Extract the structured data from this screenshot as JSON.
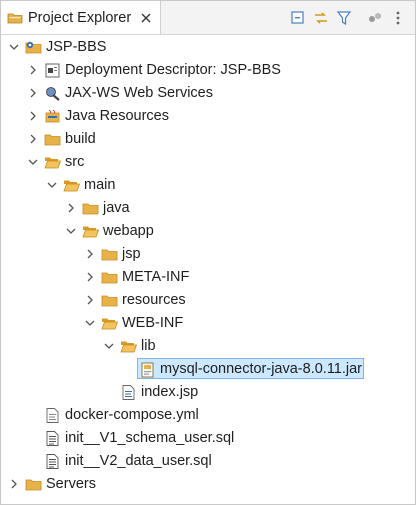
{
  "view": {
    "tab_title": "Project Explorer",
    "tab_icon": "folder-icon",
    "toolbar": [
      "collapse-all-icon",
      "link-with-editor-icon",
      "filter-icon",
      "focus-icon",
      "view-menu-icon"
    ]
  },
  "tree": {
    "rows": [
      {
        "label": "JSP-BBS",
        "icon": "project-icon",
        "state": "expanded"
      },
      {
        "label": "Deployment Descriptor: JSP-BBS",
        "icon": "deployment-descriptor-icon",
        "state": "collapsed"
      },
      {
        "label": "JAX-WS Web Services",
        "icon": "web-services-icon",
        "state": "collapsed"
      },
      {
        "label": "Java Resources",
        "icon": "java-resources-icon",
        "state": "collapsed"
      },
      {
        "label": "build",
        "icon": "folder-icon",
        "state": "collapsed"
      },
      {
        "label": "src",
        "icon": "folder-open-icon",
        "state": "expanded"
      },
      {
        "label": "main",
        "icon": "folder-open-icon",
        "state": "expanded"
      },
      {
        "label": "java",
        "icon": "folder-icon",
        "state": "collapsed"
      },
      {
        "label": "webapp",
        "icon": "folder-open-icon",
        "state": "expanded"
      },
      {
        "label": "jsp",
        "icon": "folder-icon",
        "state": "collapsed"
      },
      {
        "label": "META-INF",
        "icon": "folder-icon",
        "state": "collapsed"
      },
      {
        "label": "resources",
        "icon": "folder-icon",
        "state": "collapsed"
      },
      {
        "label": "WEB-INF",
        "icon": "folder-open-icon",
        "state": "expanded"
      },
      {
        "label": "lib",
        "icon": "folder-open-icon",
        "state": "expanded"
      },
      {
        "label": "mysql-connector-java-8.0.11.jar",
        "icon": "jar-icon",
        "state": "leaf",
        "selected": true
      },
      {
        "label": "index.jsp",
        "icon": "jsp-file-icon",
        "state": "leaf"
      },
      {
        "label": "docker-compose.yml",
        "icon": "yml-file-icon",
        "state": "leaf"
      },
      {
        "label": "init__V1_schema_user.sql",
        "icon": "sql-file-icon",
        "state": "leaf"
      },
      {
        "label": "init__V2_data_user.sql",
        "icon": "sql-file-icon",
        "state": "leaf"
      },
      {
        "label": "Servers",
        "icon": "folder-icon",
        "state": "collapsed"
      }
    ]
  },
  "colors": {
    "selection_bg": "#cce8ff",
    "selection_border": "#7eb4ea",
    "folder": "#e8b24a",
    "folder_dark": "#c98a1a"
  }
}
